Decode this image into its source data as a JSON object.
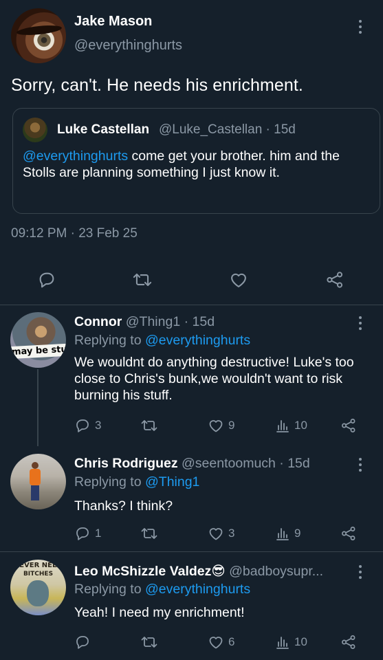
{
  "main_tweet": {
    "name": "Jake Mason",
    "handle": "@everythinghurts",
    "text": "Sorry, can't. He needs his enrichment.",
    "quote": {
      "name": "Luke Castellan",
      "handle": "@Luke_Castellan · 15d",
      "mention": "@everythinghurts",
      "text_after_mention": " come get your brother. him and the Stolls are planning something I just know it."
    },
    "timestamp": "09:12 PM · 23 Feb 25",
    "icons": [
      "reply-icon",
      "retweet-icon",
      "like-icon",
      "share-icon"
    ]
  },
  "replies": [
    {
      "name": "Connor",
      "handle": "@Thing1 · 15d",
      "replying_prefix": "Replying to ",
      "replying_to": "@everythinghurts",
      "text": "We wouldnt do anything destructive! Luke's too close to Chris's bunk,we wouldn't want to risk burning his stuff.",
      "avatar_caption": "may be stupi",
      "stats": {
        "replies": "3",
        "retweets": "",
        "likes": "9",
        "views": "10"
      }
    },
    {
      "name": "Chris Rodriguez",
      "handle": "@seentoomuch · 15d",
      "replying_prefix": "Replying to ",
      "replying_to": "@Thing1",
      "text": "Thanks? I think?",
      "stats": {
        "replies": "1",
        "retweets": "",
        "likes": "3",
        "views": "9"
      }
    },
    {
      "name": "Leo McShizzle Valdez😎",
      "handle": "@badboysupr...",
      "replying_prefix": "Replying to ",
      "replying_to": "@everythinghurts",
      "text": "Yeah! I need my enrichment!",
      "avatar_caption_top": "NEVER NEED",
      "avatar_caption_bottom": "BITCHES",
      "stats": {
        "replies": "",
        "retweets": "",
        "likes": "6",
        "views": "10"
      }
    }
  ],
  "colors": {
    "background": "#15202b",
    "muted": "#8b98a5",
    "link": "#1d9bf0",
    "border": "#38444d"
  }
}
